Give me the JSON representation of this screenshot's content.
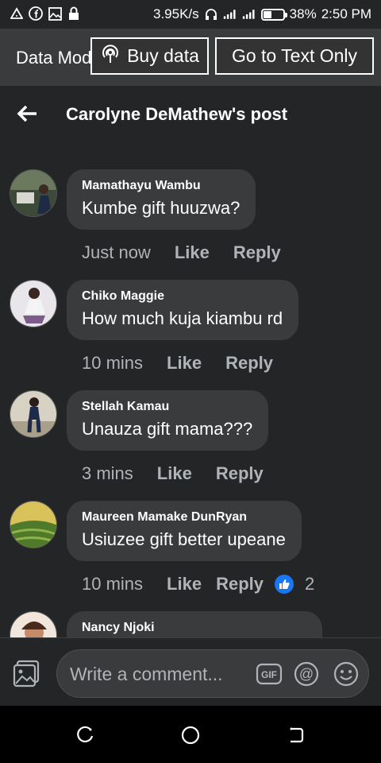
{
  "status_bar": {
    "network_speed": "3.95K/s",
    "battery_percent": "38%",
    "battery_level": 0.38,
    "time": "2:50 PM"
  },
  "data_bar": {
    "label": "Data Mode",
    "buy_data_label": "Buy data",
    "text_only_label": "Go to Text Only"
  },
  "header": {
    "title": "Carolyne DeMathew's post"
  },
  "comments": [
    {
      "author": "Mamathayu Wambu",
      "text": "Kumbe gift huuzwa?",
      "time": "Just now",
      "like": "Like",
      "reply": "Reply"
    },
    {
      "author": "Chiko Maggie",
      "text": "How much kuja kiambu rd",
      "time": "10 mins",
      "like": "Like",
      "reply": "Reply"
    },
    {
      "author": "Stellah Kamau",
      "text": "Unauza gift mama???",
      "time": "3 mins",
      "like": "Like",
      "reply": "Reply"
    },
    {
      "author": "Maureen Mamake DunRyan",
      "text": "Usiuzee gift better upeane",
      "time": "10 mins",
      "like": "Like",
      "reply": "Reply",
      "reaction_count": "2"
    },
    {
      "author": "Nancy Njoki",
      "text": "",
      "time": "",
      "like": "",
      "reply": ""
    }
  ],
  "composer": {
    "placeholder": "Write a comment..."
  },
  "colors": {
    "background": "#242526",
    "bubble": "#3a3b3c",
    "like_blue": "#1877f2"
  }
}
